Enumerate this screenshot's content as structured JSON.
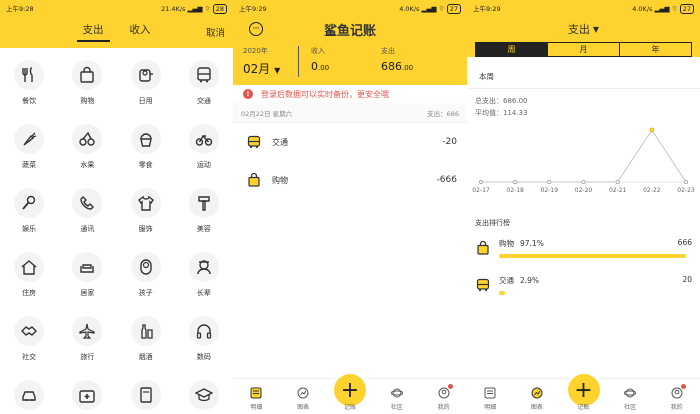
{
  "colors": {
    "accent": "#FED32F",
    "alert": "#e5534b",
    "dark": "#222222"
  },
  "screen1": {
    "status": {
      "time": "上午9:28",
      "net": "21.4K/s",
      "battery": "28"
    },
    "tabs": [
      "支出",
      "收入"
    ],
    "cancel": "取消",
    "categories": [
      {
        "label": "餐饮",
        "icon": "utensils-icon"
      },
      {
        "label": "购物",
        "icon": "shopping-bag-icon"
      },
      {
        "label": "日用",
        "icon": "toilet-paper-icon"
      },
      {
        "label": "交通",
        "icon": "bus-icon"
      },
      {
        "label": "蔬菜",
        "icon": "carrot-icon"
      },
      {
        "label": "水果",
        "icon": "cherry-icon"
      },
      {
        "label": "零食",
        "icon": "cupcake-icon"
      },
      {
        "label": "运动",
        "icon": "bicycle-icon"
      },
      {
        "label": "娱乐",
        "icon": "microphone-icon"
      },
      {
        "label": "通讯",
        "icon": "phone-icon"
      },
      {
        "label": "服饰",
        "icon": "tshirt-icon"
      },
      {
        "label": "美容",
        "icon": "brush-icon"
      },
      {
        "label": "住房",
        "icon": "house-icon"
      },
      {
        "label": "居家",
        "icon": "sofa-icon"
      },
      {
        "label": "孩子",
        "icon": "baby-icon"
      },
      {
        "label": "长辈",
        "icon": "elder-icon"
      },
      {
        "label": "社交",
        "icon": "handshake-icon"
      },
      {
        "label": "旅行",
        "icon": "airplane-icon"
      },
      {
        "label": "烟酒",
        "icon": "bottle-icon"
      },
      {
        "label": "数码",
        "icon": "headphones-icon"
      },
      {
        "label": "汽车",
        "icon": "car-icon"
      },
      {
        "label": "医疗",
        "icon": "medical-kit-icon"
      },
      {
        "label": "书籍",
        "icon": "book-icon"
      },
      {
        "label": "学习",
        "icon": "graduation-cap-icon"
      }
    ]
  },
  "screen2": {
    "status": {
      "time": "上午9:29",
      "net": "4.0K/s",
      "battery": "27"
    },
    "title": "鲨鱼记账",
    "year": "2020年",
    "month": "02月",
    "income_label": "收入",
    "income_value": "0",
    "income_dec": ".00",
    "expense_label": "支出",
    "expense_value": "686",
    "expense_dec": ".00",
    "banner": "登录后数据可以实时备份，更安全哦",
    "day_header": "02月22日 星期六",
    "day_total": "支出：686",
    "records": [
      {
        "name": "交通",
        "amount": "-20",
        "icon": "bus-icon"
      },
      {
        "name": "购物",
        "amount": "-666",
        "icon": "shopping-bag-icon"
      }
    ],
    "tabbar": [
      "明细",
      "图表",
      "记账",
      "社区",
      "我的"
    ]
  },
  "screen3": {
    "status": {
      "time": "上午9:29",
      "net": "4.0K/s",
      "battery": "27"
    },
    "title": "支出",
    "segments": [
      "周",
      "月",
      "年"
    ],
    "period": "本周",
    "total": "总支出：686.00",
    "average": "平均值：114.33",
    "rank_title": "支出排行榜",
    "ranking": [
      {
        "name": "购物",
        "pct": "97.1%",
        "amount": "666",
        "fraction": 0.971
      },
      {
        "name": "交通",
        "pct": "2.9%",
        "amount": "20",
        "fraction": 0.029
      }
    ],
    "tabbar": [
      "明细",
      "图表",
      "记账",
      "社区",
      "我的"
    ]
  },
  "chart_data": {
    "type": "line",
    "categories": [
      "02-17",
      "02-18",
      "02-19",
      "02-20",
      "02-21",
      "02-22",
      "02-23"
    ],
    "values": [
      0,
      0,
      0,
      0,
      0,
      686,
      0
    ],
    "ylim": [
      0,
      686
    ]
  }
}
